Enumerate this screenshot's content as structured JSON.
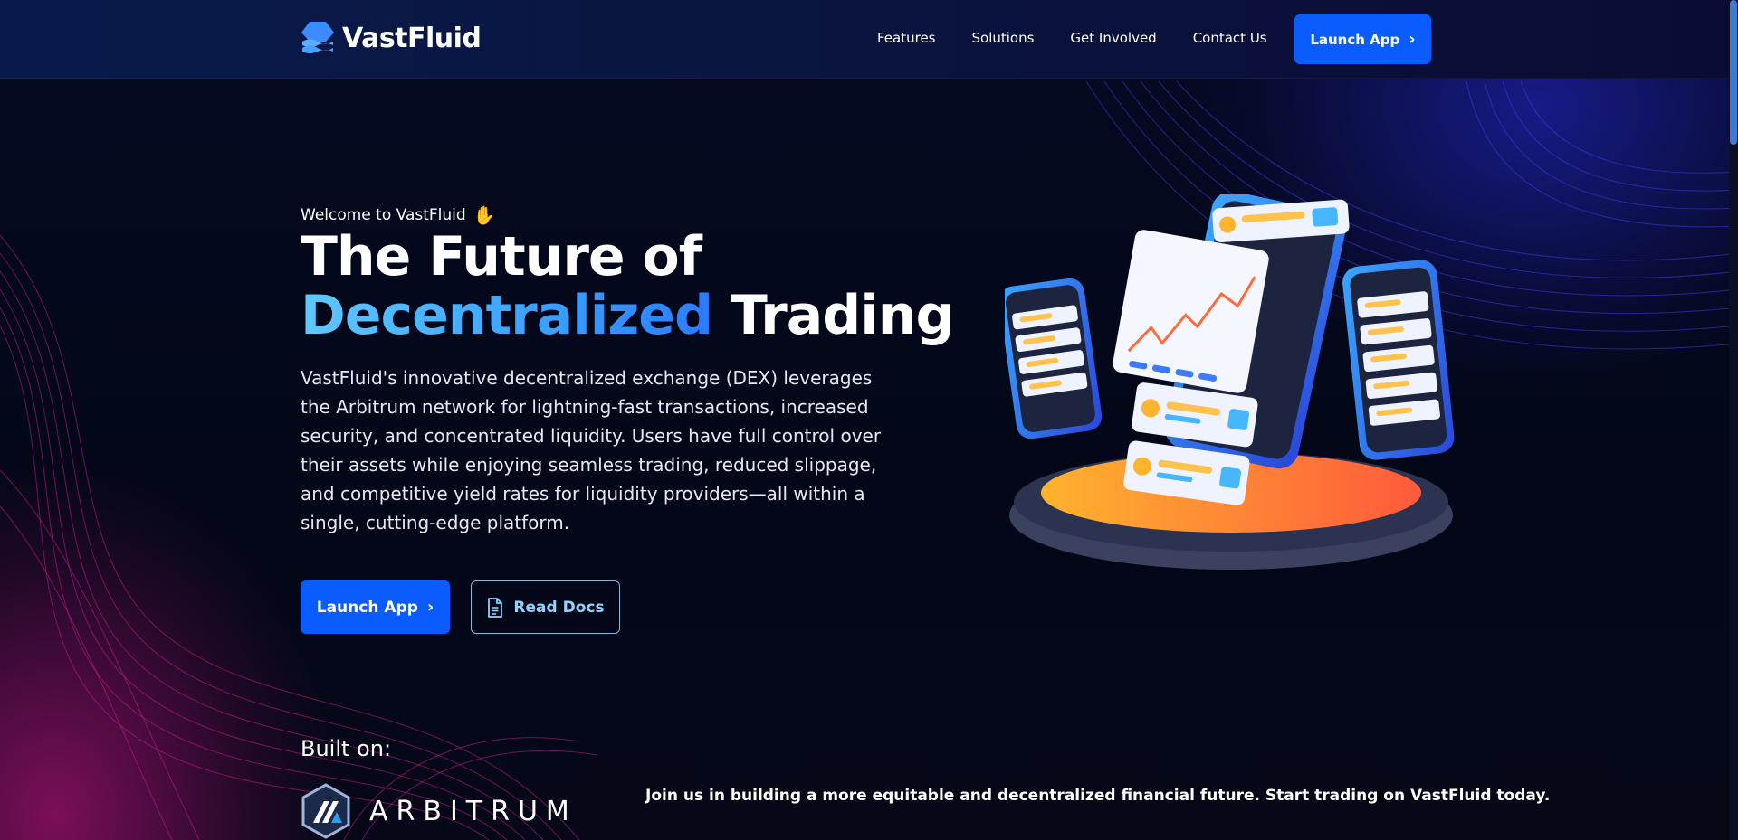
{
  "brand": {
    "name": "VastFluid",
    "logo_icon": "vastfluid-logo-icon"
  },
  "nav": {
    "links": [
      "Features",
      "Solutions",
      "Get Involved",
      "Contact Us"
    ],
    "cta_label": "Launch App"
  },
  "hero": {
    "welcome": "Welcome to VastFluid",
    "welcome_icon": "waving-hand-icon",
    "title_line1": "The Future of",
    "title_accent": "Decentralized",
    "title_rest": "Trading",
    "description": "VastFluid's innovative decentralized exchange (DEX) leverages the Arbitrum network for lightning-fast transactions, increased security, and concentrated liquidity. Users have full control over their assets while enjoying seamless trading, reduced slippage, and competitive yield rates for liquidity providers—all within a single, cutting-edge platform.",
    "primary_button": "Launch App",
    "secondary_button": "Read Docs",
    "secondary_icon": "document-icon"
  },
  "built_on": {
    "label": "Built on:",
    "partner": "ARBITRUM",
    "partner_icon": "arbitrum-logo-icon"
  },
  "cta_line": "Join us in building a more equitable and decentralized financial future. Start trading on VastFluid today.",
  "colors": {
    "accent_blue": "#0a5cff",
    "accent_gradient_start": "#5ec8ff",
    "background": "#03081c",
    "magenta_glow": "#dc148c"
  }
}
